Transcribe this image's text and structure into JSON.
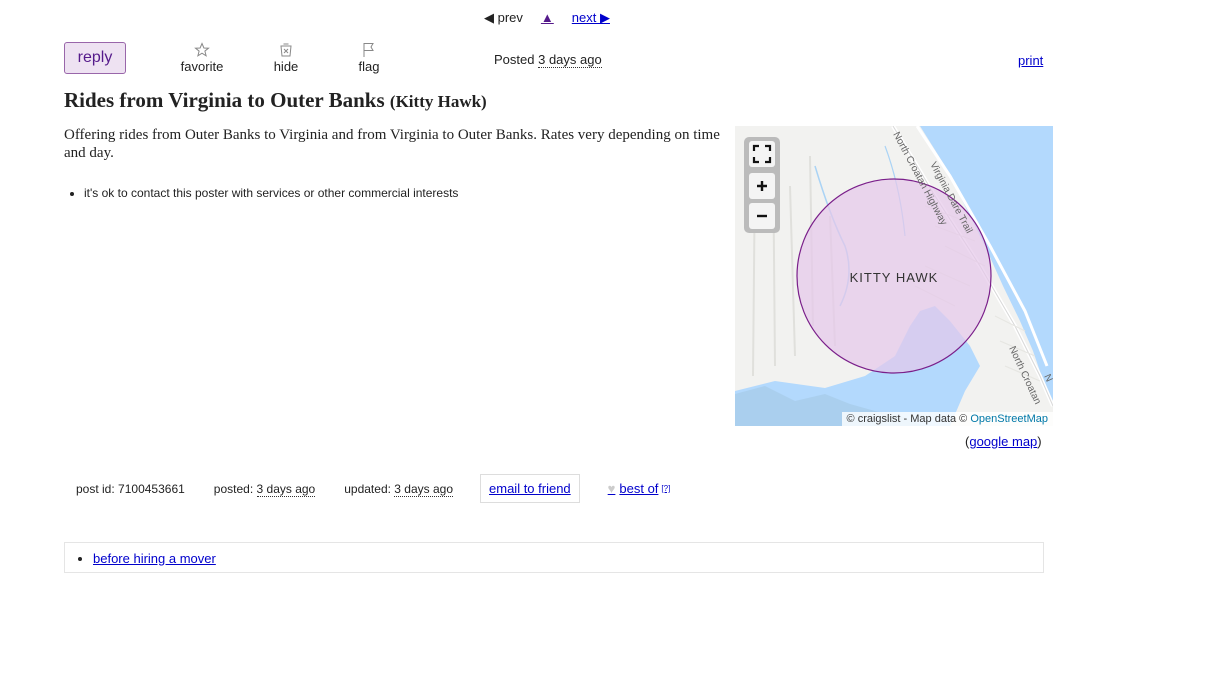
{
  "nav": {
    "prev": "◀ prev",
    "up": "▲",
    "next": "next ▶"
  },
  "actions": {
    "reply": "reply",
    "favorite": "favorite",
    "hide": "hide",
    "flag": "flag",
    "posted_label": "Posted",
    "posted_value": "3 days ago",
    "print": "print"
  },
  "post": {
    "title": "Rides from Virginia to Outer Banks",
    "location": "(Kitty Hawk)",
    "body": "Offering rides from Outer Banks to Virginia and from Virginia to Outer Banks. Rates very depending on time and day.",
    "notices": [
      "it's ok to contact this poster with services or other commercial interests"
    ]
  },
  "map": {
    "place_label": "KITTY HAWK",
    "roads": [
      "North Croatan Highway",
      "Virginia Dare Trail",
      "North Croatan",
      "N"
    ],
    "attribution_prefix": "© craigslist - Map data ©",
    "attribution_link": "OpenStreetMap",
    "google_map": "google map",
    "colors": {
      "water": "#b3d9fd",
      "land": "#f2f2f0",
      "circle_fill": "#e6c8ea",
      "circle_stroke": "#7a1f8a"
    }
  },
  "postinfo": {
    "post_id_label": "post id:",
    "post_id": "7100453661",
    "posted_label": "posted:",
    "posted_value": "3 days ago",
    "updated_label": "updated:",
    "updated_value": "3 days ago",
    "email_friend": "email to friend",
    "best_of": "best of",
    "best_of_sup": "[?]"
  },
  "footer": {
    "links": [
      "before hiring a mover"
    ]
  }
}
